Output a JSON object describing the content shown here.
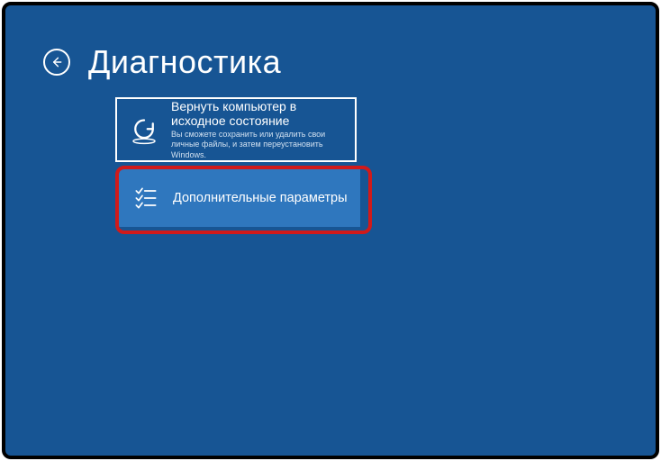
{
  "header": {
    "title": "Диагностика"
  },
  "tiles": {
    "reset": {
      "title": "Вернуть компьютер в исходное состояние",
      "desc": "Вы сможете сохранить или удалить свои личные файлы, и затем переустановить Windows."
    },
    "advanced": {
      "title": "Дополнительные параметры"
    }
  }
}
